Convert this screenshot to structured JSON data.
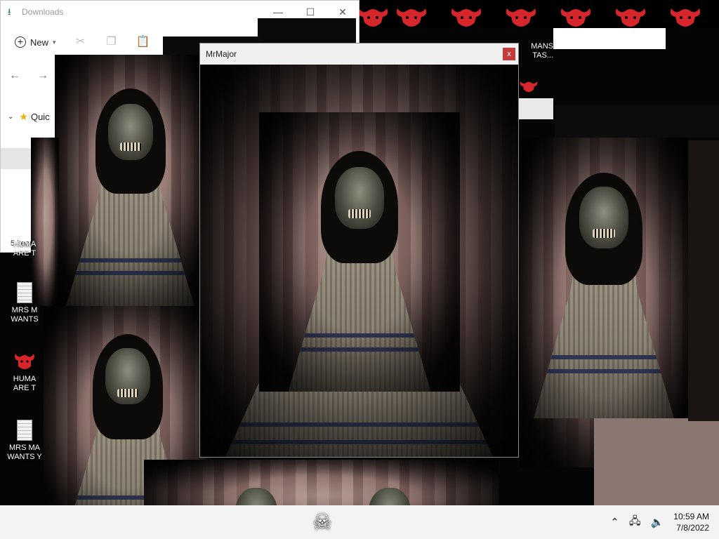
{
  "explorer": {
    "title": "Downloads",
    "new_label": "New",
    "quick_access_label": "Quic",
    "status": "5 item"
  },
  "desktop_icons": [
    {
      "label": "HUMA\nARE T"
    },
    {
      "label": "MRS M\nWANTS"
    },
    {
      "label": "HUMA\nARE T"
    },
    {
      "label": "MRS MA\nWANTS Y"
    }
  ],
  "top_right_icon": {
    "label": "MANS\nTAS..."
  },
  "mrmajor": {
    "title": "MrMajor",
    "close": "x"
  },
  "taskbar": {
    "time": "10:59 AM",
    "date": "7/8/2022"
  },
  "icons": {
    "download": "download-icon",
    "skull": "skull-crossbones-icon",
    "demon": "red-demon-icon"
  },
  "colors": {
    "demon_red": "#d6262b",
    "close_red": "#c43c3c",
    "taskbar": "#f3f3f3"
  }
}
